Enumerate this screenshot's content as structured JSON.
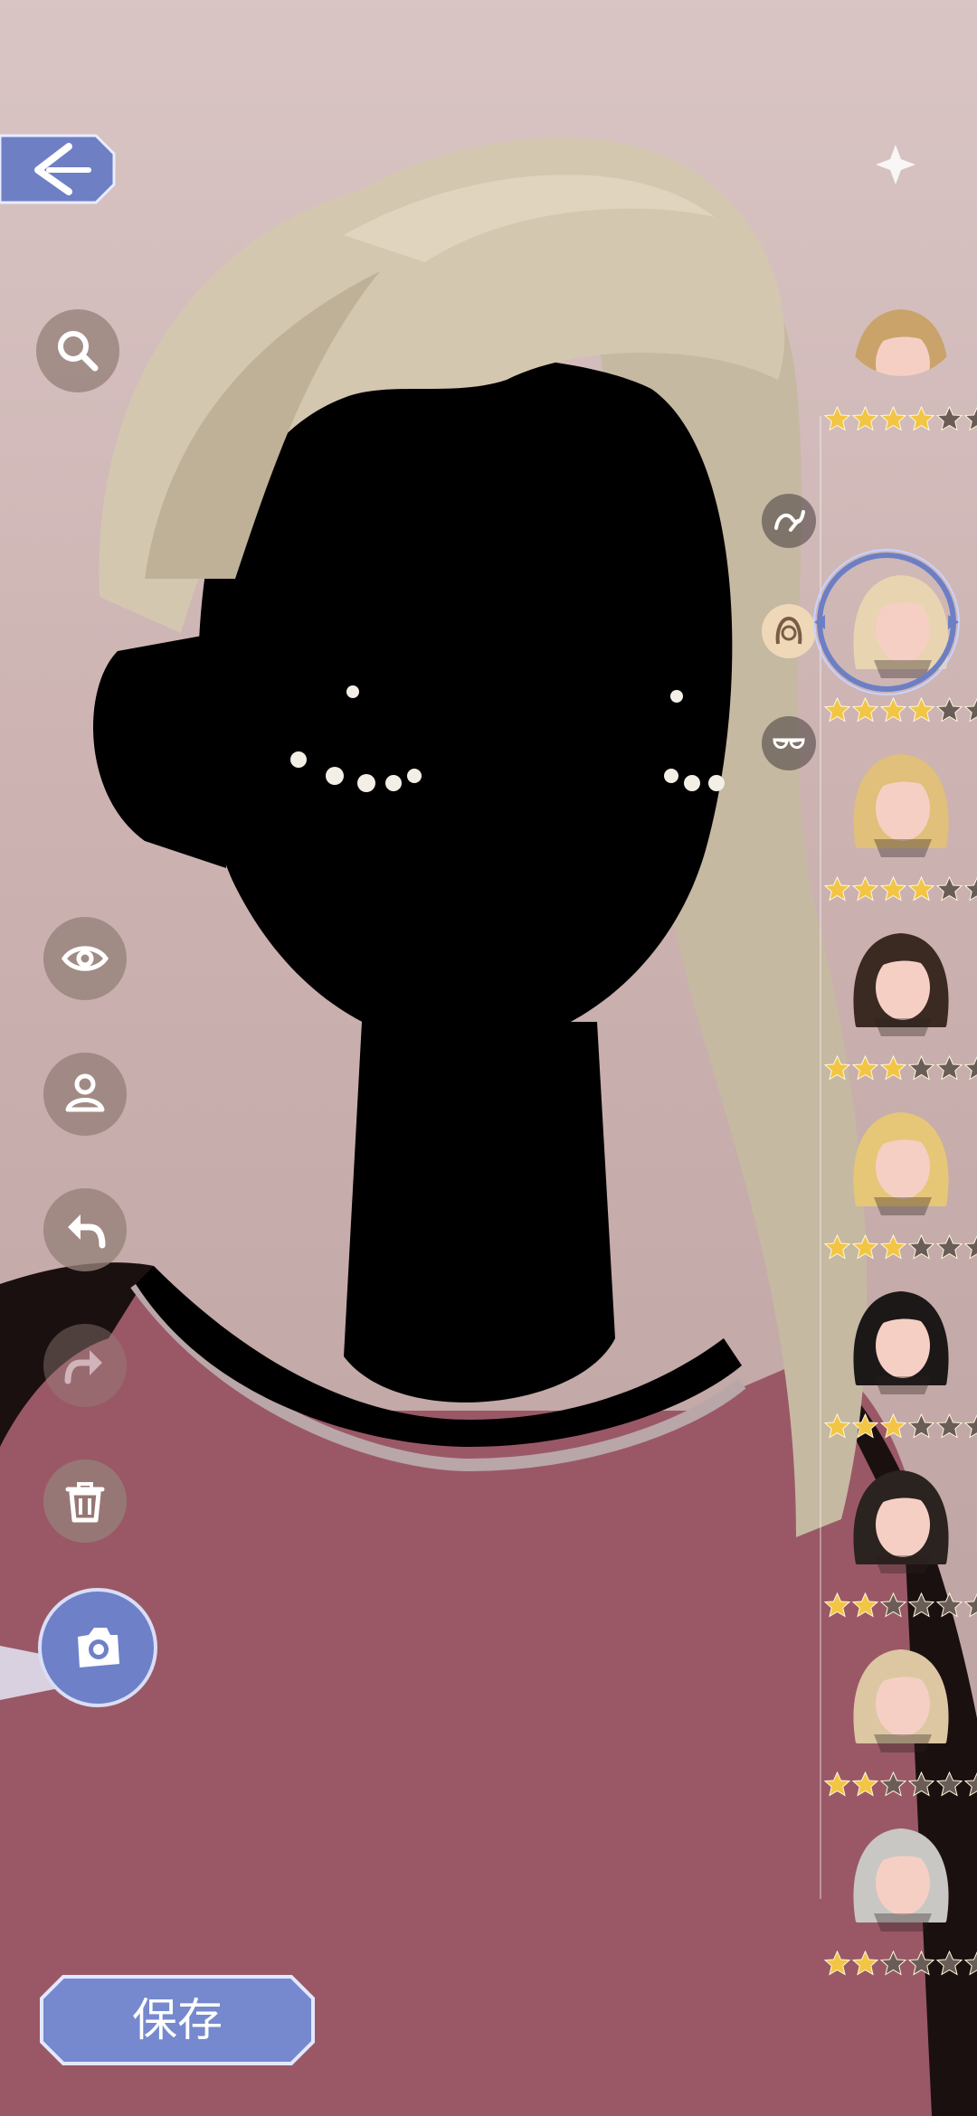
{
  "screen": {
    "name": "hair-selection"
  },
  "save_button": {
    "label": "保存"
  },
  "left_toolbar": [
    {
      "name": "search-button",
      "icon": "search-icon"
    },
    {
      "name": "visibility-button",
      "icon": "eye-icon"
    },
    {
      "name": "hanger-button",
      "icon": "hanger-icon"
    },
    {
      "name": "undo-button",
      "icon": "undo-icon"
    },
    {
      "name": "redo-button",
      "icon": "redo-icon"
    },
    {
      "name": "delete-button",
      "icon": "trash-icon"
    },
    {
      "name": "camera-button",
      "icon": "camera-icon"
    }
  ],
  "category_tabs": [
    {
      "name": "tab-hair-accessory",
      "icon": "hair-tie-icon"
    },
    {
      "name": "tab-hair",
      "icon": "hair-icon",
      "active": true
    },
    {
      "name": "tab-eyewear",
      "icon": "glasses-icon"
    }
  ],
  "hair_items": [
    {
      "stars": 4,
      "max": 6,
      "hair_color": "#c9a36a",
      "partial": true
    },
    {
      "stars": 4,
      "max": 6,
      "hair_color": "#e8d4b0",
      "selected": true
    },
    {
      "stars": 4,
      "max": 6,
      "hair_color": "#e0c07a"
    },
    {
      "stars": 3,
      "max": 6,
      "hair_color": "#3a2a22"
    },
    {
      "stars": 3,
      "max": 6,
      "hair_color": "#e6c777"
    },
    {
      "stars": 3,
      "max": 6,
      "hair_color": "#1c1818"
    },
    {
      "stars": 2,
      "max": 6,
      "hair_color": "#2a2320"
    },
    {
      "stars": 2,
      "max": 6,
      "hair_color": "#dcc7a2"
    },
    {
      "stars": 2,
      "max": 6,
      "hair_color": "#c9c7c3"
    }
  ],
  "colors": {
    "star_on": "#f2c545",
    "star_off": "#6a5d58",
    "accent_blue": "#6d7fc4",
    "shirt": "#9a5866"
  }
}
